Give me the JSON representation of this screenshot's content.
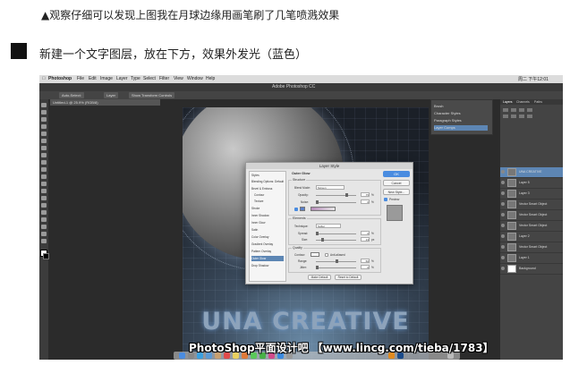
{
  "caption_top": "▲观察仔细可以发现上图我在月球边缘用画笔刷了几笔喷溅效果",
  "caption_step": "新建一个文字图层，放在下方，效果外发光（蓝色）",
  "app": {
    "menubar": [
      "Photoshop",
      "File",
      "Edit",
      "Image",
      "Layer",
      "Type",
      "Select",
      "Filter",
      "View",
      "Window",
      "Help"
    ],
    "window_title": "Adobe Photoshop CC",
    "clock": "周二 下午12:01",
    "options_buttons": [
      "Auto-Select:",
      "Layer",
      "Show Transform Controls"
    ],
    "doc_tab": "Untitled-1 @ 25.9% (RGB/8)"
  },
  "canvas": {
    "text": "UNA CREATIVE"
  },
  "navigator": {
    "rows": [
      "Brush",
      "Character Styles",
      "Paragraph Styles",
      "Layer Comps"
    ],
    "selected_index": 3
  },
  "layers_panel": {
    "tabs": [
      "Layers",
      "Channels",
      "Paths"
    ],
    "layers": [
      {
        "name": "UNA CREATIVE",
        "selected": true
      },
      {
        "name": "Layer 5",
        "selected": false
      },
      {
        "name": "Layer 3",
        "selected": false
      },
      {
        "name": "Vector Smart Object",
        "selected": false
      },
      {
        "name": "Vector Smart Object",
        "selected": false
      },
      {
        "name": "Vector Smart Object",
        "selected": false
      },
      {
        "name": "Layer 2",
        "selected": false
      },
      {
        "name": "Vector Smart Object",
        "selected": false
      },
      {
        "name": "Layer 1",
        "selected": false
      },
      {
        "name": "Background",
        "selected": false
      }
    ]
  },
  "layer_style": {
    "title": "Layer Style",
    "styles": [
      {
        "label": "Styles",
        "checked": false
      },
      {
        "label": "Blending Options: Default",
        "checked": false
      },
      {
        "label": "Bevel & Emboss",
        "checked": false
      },
      {
        "label": "Contour",
        "checked": false
      },
      {
        "label": "Texture",
        "checked": false
      },
      {
        "label": "Stroke",
        "checked": false
      },
      {
        "label": "Inner Shadow",
        "checked": false
      },
      {
        "label": "Inner Glow",
        "checked": false
      },
      {
        "label": "Satin",
        "checked": false
      },
      {
        "label": "Color Overlay",
        "checked": false
      },
      {
        "label": "Gradient Overlay",
        "checked": false
      },
      {
        "label": "Pattern Overlay",
        "checked": false
      },
      {
        "label": "Outer Glow",
        "checked": true
      },
      {
        "label": "Drop Shadow",
        "checked": false
      }
    ],
    "selected_style_index": 12,
    "section_title": "Outer Glow",
    "structure": {
      "label": "Structure",
      "blend_mode_label": "Blend Mode:",
      "blend_mode": "Screen",
      "opacity_label": "Opacity:",
      "opacity": "75",
      "noise_label": "Noise:",
      "noise": "0",
      "glow_color": "#5a7fc8",
      "gradient_color": "#b58ab8"
    },
    "elements": {
      "label": "Elements",
      "technique_label": "Technique:",
      "technique": "Softer",
      "spread_label": "Spread:",
      "spread": "0",
      "size_label": "Size:",
      "size": "13"
    },
    "quality": {
      "label": "Quality",
      "contour_label": "Contour:",
      "anti_aliased_label": "Anti-aliased",
      "range_label": "Range:",
      "range": "50",
      "jitter_label": "Jitter:",
      "jitter": "0"
    },
    "buttons": {
      "make_default": "Make Default",
      "reset_default": "Reset to Default",
      "ok": "OK",
      "cancel": "Cancel",
      "new_style": "New Style...",
      "preview": "Preview"
    }
  },
  "watermark": "PhotoShop平面设计吧 【www.lincg.com/tieba/1783】"
}
